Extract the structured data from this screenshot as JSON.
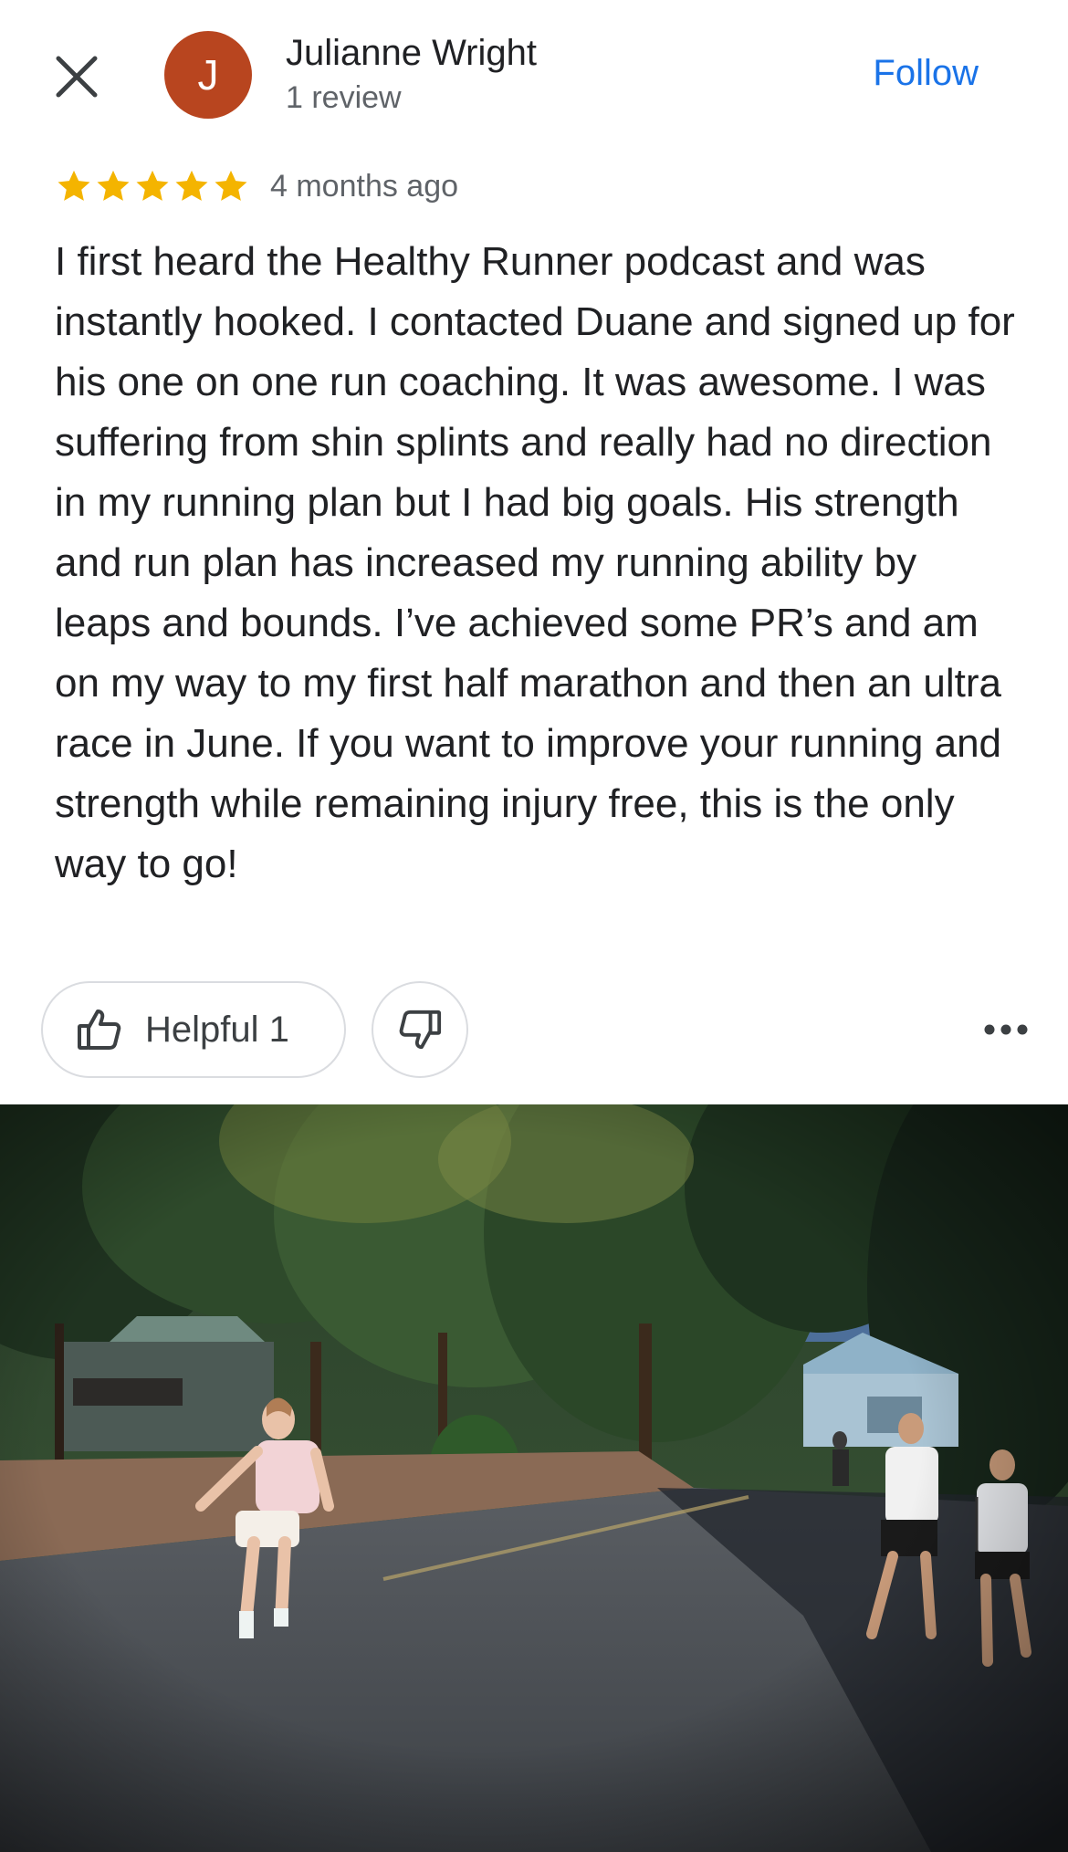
{
  "header": {
    "close_icon": "close-icon",
    "avatar_letter": "J",
    "avatar_color": "#b8451f",
    "reviewer_name": "Julianne Wright",
    "reviewer_review_count": "1 review",
    "follow_label": "Follow",
    "follow_color": "#1a73e8"
  },
  "review": {
    "rating": 5,
    "rating_max": 5,
    "star_color": "#f4b400",
    "time_ago": "4 months ago",
    "text": "I first heard the Healthy Runner podcast and was instantly hooked. I contacted Duane and signed up for his one on one run coaching. It was awesome. I was suffering from shin splints and really had no direction in my running plan but I had big goals. His strength and run plan has increased my running ability by leaps and bounds. I’ve achieved some PR’s and am on my way to my first half marathon and then an ultra race in June. If you want to improve your running and strength while remaining injury free, this is the only way to go!"
  },
  "actions": {
    "helpful_label": "Helpful 1",
    "helpful_icon": "thumbs-up-icon",
    "not_helpful_icon": "thumbs-down-icon",
    "more_icon": "more-horizontal-icon"
  },
  "photo": {
    "subject": "review-photo"
  }
}
